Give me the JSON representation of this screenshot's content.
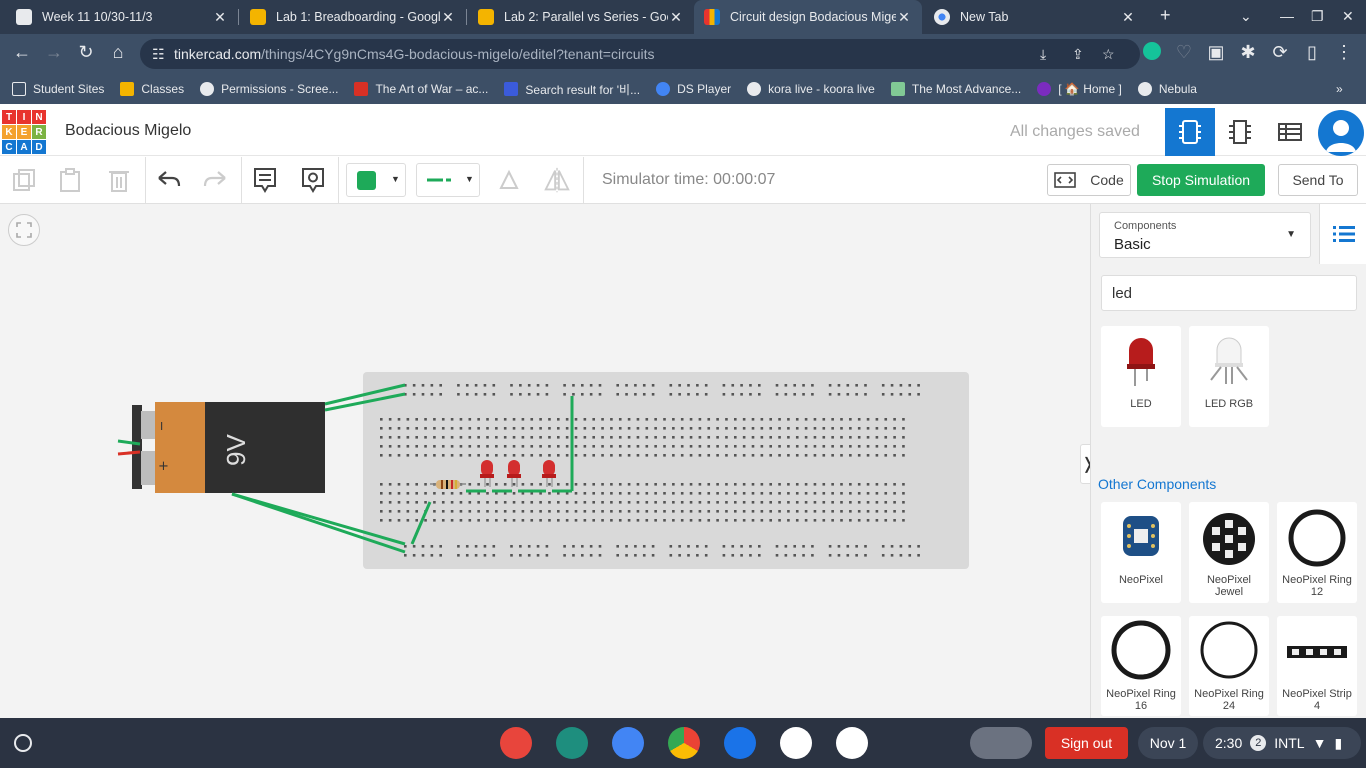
{
  "browser": {
    "tabs": [
      {
        "title": "Week 11 10/30-11/3",
        "favicon_color": "#e8eaed"
      },
      {
        "title": "Lab 1: Breadboarding - Google",
        "favicon_color": "#f4b400"
      },
      {
        "title": "Lab 2: Parallel vs Series - Goog",
        "favicon_color": "#f4b400"
      },
      {
        "title": "Circuit design Bodacious Mige",
        "favicon_color": "#1477d1",
        "active": true
      },
      {
        "title": "New Tab",
        "favicon_color": "#e8eaed"
      }
    ],
    "url_domain": "tinkercad.com",
    "url_path": "/things/4CYg9nCms4G-bodacious-migelo/editel?tenant=circuits",
    "bookmarks": [
      {
        "label": "Student Sites",
        "color": "#e8eaed"
      },
      {
        "label": "Classes",
        "color": "#f4b400"
      },
      {
        "label": "Permissions - Scree...",
        "color": "#e8eaed"
      },
      {
        "label": "The Art of War – ac...",
        "color": "#d93025"
      },
      {
        "label": "Search result for '비...",
        "color": "#3b5bdb"
      },
      {
        "label": "DS Player",
        "color": "#4285f4"
      },
      {
        "label": "kora live - koora live",
        "color": "#e8eaed"
      },
      {
        "label": "The Most Advance...",
        "color": "#81c995"
      },
      {
        "label": "[ 🏠 Home ]",
        "color": "#7b2cbf"
      },
      {
        "label": "Nebula",
        "color": "#e8eaed"
      }
    ]
  },
  "tinkercad": {
    "logo_letters": [
      "T",
      "I",
      "N",
      "K",
      "E",
      "R",
      "C",
      "A",
      "D"
    ],
    "project_name": "Bodacious Migelo",
    "save_status": "All changes saved",
    "simulator_time": "Simulator time: 00:00:07",
    "code_label": "Code",
    "stop_label": "Stop Simulation",
    "send_label": "Send To",
    "battery_label": "9V",
    "accent": "#1477d1",
    "stop_color": "#1eaa59"
  },
  "panel": {
    "components_label": "Components",
    "components_value": "Basic",
    "search_value": "led",
    "results": [
      {
        "label": "LED"
      },
      {
        "label": "LED RGB"
      }
    ],
    "other_label": "Other Components",
    "other": [
      {
        "line1": "NeoPixel",
        "line2": ""
      },
      {
        "line1": "NeoPixel",
        "line2": "Jewel"
      },
      {
        "line1": "NeoPixel Ring",
        "line2": "12"
      },
      {
        "line1": "NeoPixel Ring",
        "line2": "16"
      },
      {
        "line1": "NeoPixel Ring",
        "line2": "24"
      },
      {
        "line1": "NeoPixel Strip",
        "line2": "4"
      }
    ]
  },
  "shelf": {
    "signout_label": "Sign out",
    "date": "Nov 1",
    "time": "2:30",
    "notif_count": "2",
    "ime": "INTL"
  }
}
